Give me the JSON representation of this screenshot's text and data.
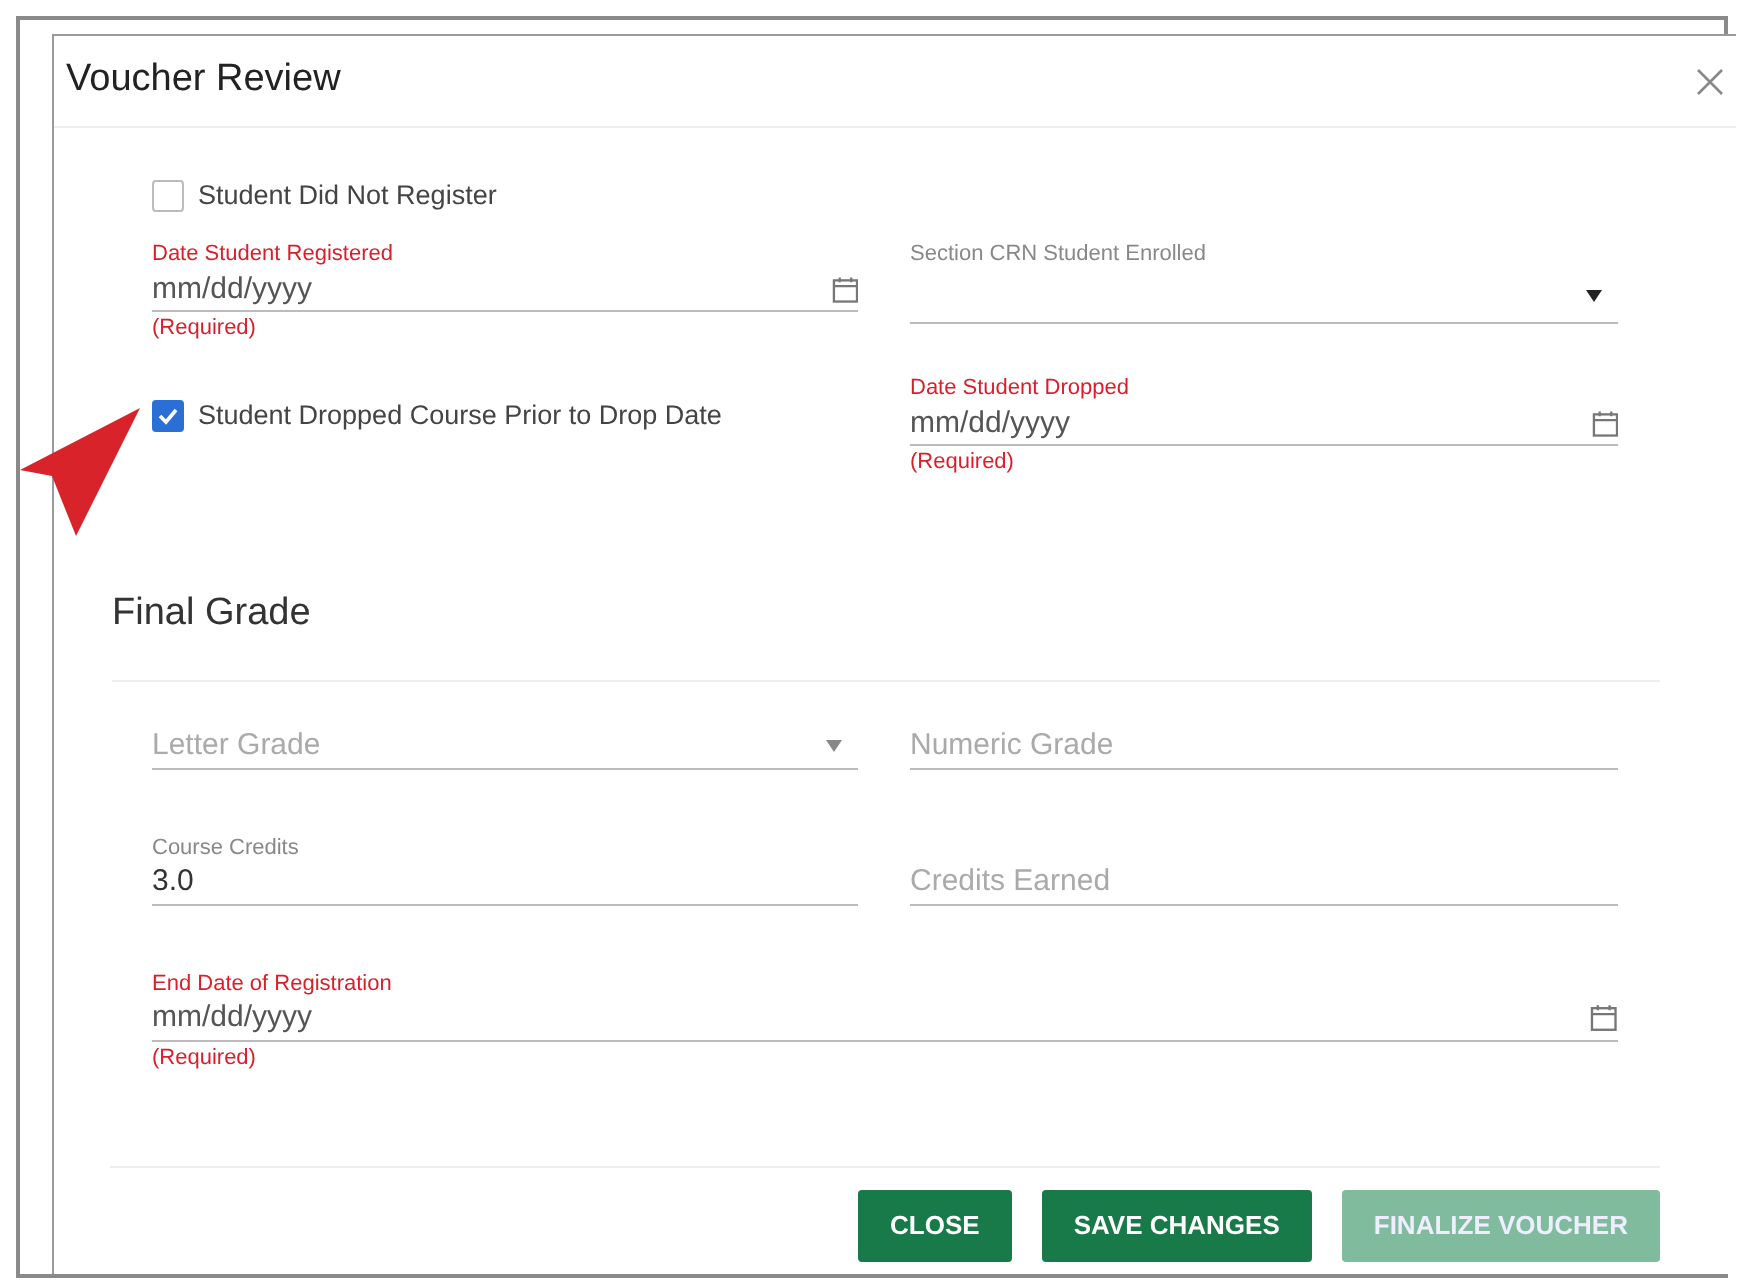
{
  "dialog": {
    "title": "Voucher Review"
  },
  "registration": {
    "not_registered": {
      "label": "Student Did Not Register",
      "checked": false
    },
    "date_registered": {
      "kind": "date",
      "label": "Date Student Registered",
      "placeholder": "mm/dd/yyyy",
      "hint": "(Required)",
      "invalid": true
    },
    "section_crn": {
      "kind": "select",
      "label": "Section CRN Student Enrolled",
      "invalid": false
    },
    "dropped": {
      "label": "Student Dropped Course Prior to Drop Date",
      "checked": true
    },
    "date_dropped": {
      "kind": "date",
      "label": "Date Student Dropped",
      "placeholder": "mm/dd/yyyy",
      "hint": "(Required)",
      "invalid": true
    }
  },
  "final_grade": {
    "heading": "Final Grade",
    "fields": [
      {
        "kind": "select",
        "placeholder": "Letter Grade"
      },
      {
        "kind": "text",
        "placeholder": "Numeric Grade"
      },
      {
        "kind": "text",
        "label": "Course Credits",
        "value": "3.0",
        "invalid": false
      },
      {
        "kind": "text",
        "placeholder": "Credits Earned"
      },
      {
        "kind": "date",
        "label": "End Date of Registration",
        "placeholder": "mm/dd/yyyy",
        "hint": "(Required)",
        "invalid": true,
        "wide": true
      }
    ]
  },
  "buttons": [
    {
      "label": "CLOSE",
      "disabled": false
    },
    {
      "label": "SAVE CHANGES",
      "disabled": false
    },
    {
      "label": "FINALIZE VOUCHER",
      "disabled": true
    }
  ]
}
